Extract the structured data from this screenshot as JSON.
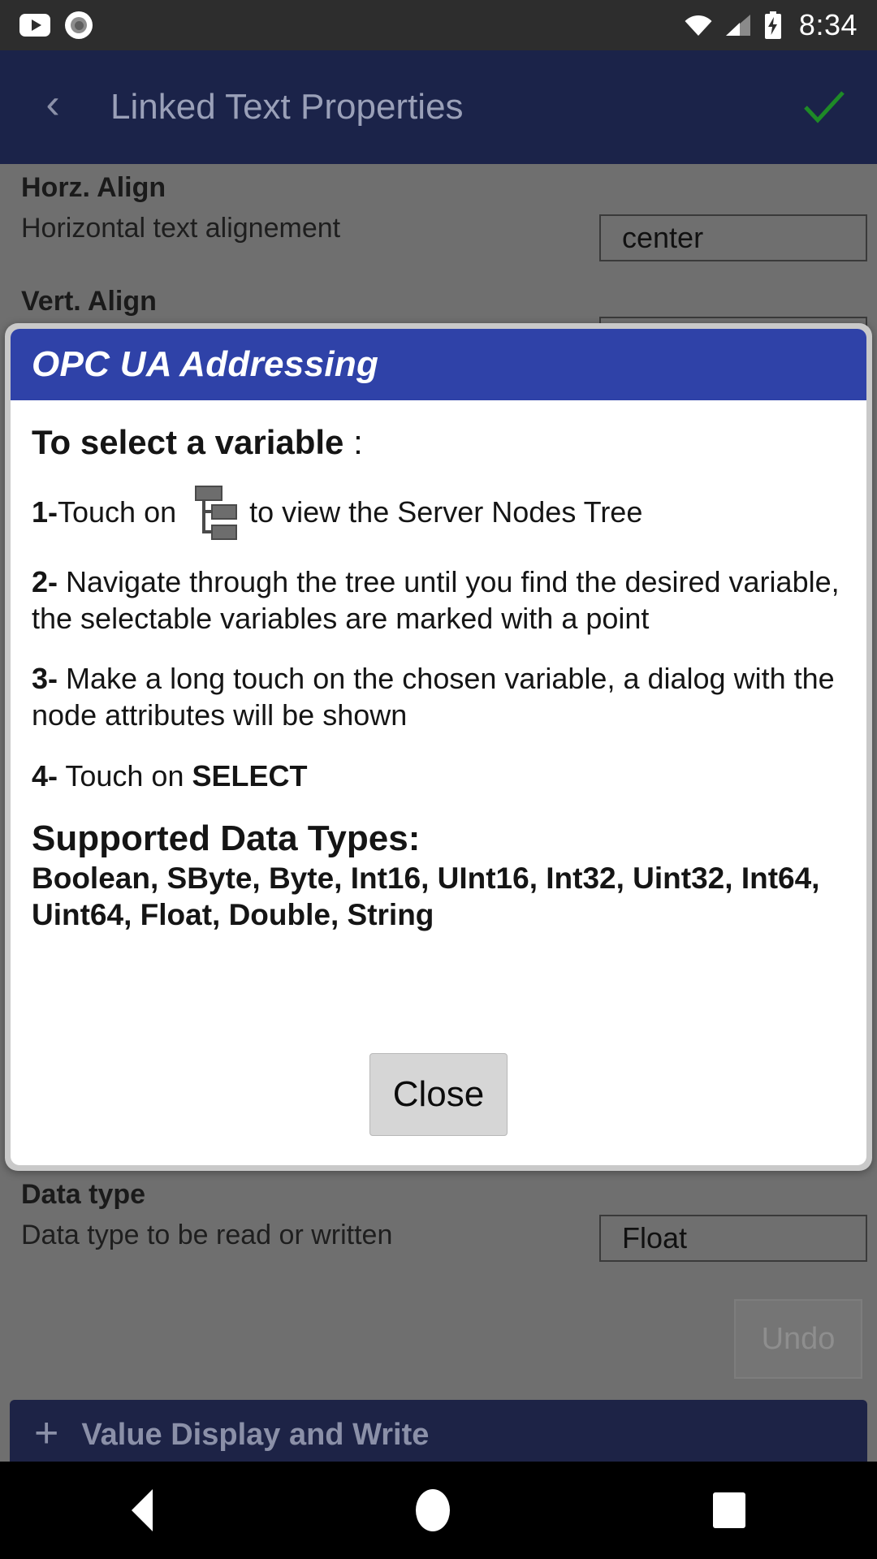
{
  "statusbar": {
    "time": "8:34",
    "icons": [
      "youtube-play-icon",
      "record-icon",
      "wifi-icon",
      "signal-icon",
      "battery-charging-icon"
    ]
  },
  "appbar": {
    "back_label": "‹",
    "title": "Linked Text Properties",
    "confirm_label": "check"
  },
  "form": {
    "rows": [
      {
        "title": "Horz. Align",
        "desc": "Horizontal text alignement",
        "value": "center"
      },
      {
        "title": "Vert. Align",
        "desc": "",
        "value": ""
      },
      {
        "title": "Data type",
        "desc": "Data type to be read or written",
        "value": "Float"
      }
    ],
    "undo_label": "Undo",
    "add_bar": {
      "plus": "+",
      "label": "Value Display and Write"
    }
  },
  "dialog": {
    "title": "OPC UA Addressing",
    "heading_bold": "To select a variable",
    "heading_thin": " :",
    "steps": [
      {
        "num": "1-",
        "text_before": " Touch on ",
        "icon": "tree-hierarchy-icon",
        "text_after": " to view the Server Nodes Tree"
      },
      {
        "num": "2-",
        "text": " Navigate through the tree until you find the desired variable, the selectable variables are marked with a point"
      },
      {
        "num": "3-",
        "text": " Make a long touch on the chosen variable, a dialog with the node attributes will be shown"
      },
      {
        "num": "4-",
        "text": " Touch on ",
        "emphasis": "SELECT"
      }
    ],
    "types_heading": "Supported Data Types:",
    "types_list": "Boolean, SByte, Byte, Int16, UInt16, Int32, Uint32, Int64, Uint64, Float, Double, String",
    "close_label": "Close"
  },
  "navbar": {
    "back": "back-triangle-icon",
    "home": "home-circle-icon",
    "recents": "recents-square-icon"
  },
  "colors": {
    "status_bar": "#2d2d2d",
    "app_bar": "#1b2349",
    "dialog_header": "#2f42a8",
    "accent_check": "#1e8a27",
    "page_bg": "#6f6f6f",
    "add_bar": "#1d2346"
  }
}
